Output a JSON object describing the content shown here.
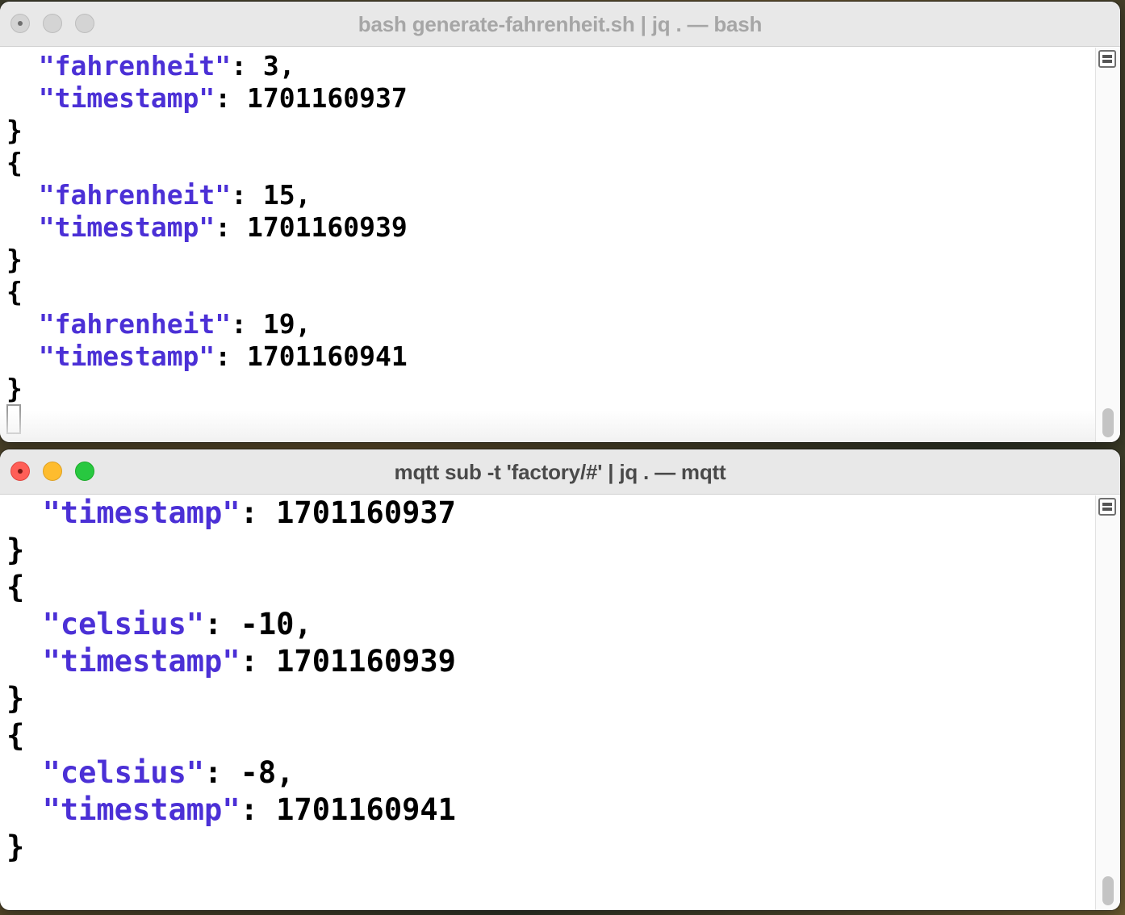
{
  "windows": [
    {
      "title": "bash generate-fahrenheit.sh | jq . — bash",
      "active": false,
      "lines": [
        {
          "indent": "  ",
          "key": "\"fahrenheit\"",
          "rest": ": 3,"
        },
        {
          "indent": "  ",
          "key": "\"timestamp\"",
          "rest": ": 1701160937"
        },
        {
          "indent": "",
          "key": "",
          "rest": "}"
        },
        {
          "indent": "",
          "key": "",
          "rest": "{"
        },
        {
          "indent": "  ",
          "key": "\"fahrenheit\"",
          "rest": ": 15,"
        },
        {
          "indent": "  ",
          "key": "\"timestamp\"",
          "rest": ": 1701160939"
        },
        {
          "indent": "",
          "key": "",
          "rest": "}"
        },
        {
          "indent": "",
          "key": "",
          "rest": "{"
        },
        {
          "indent": "  ",
          "key": "\"fahrenheit\"",
          "rest": ": 19,"
        },
        {
          "indent": "  ",
          "key": "\"timestamp\"",
          "rest": ": 1701160941"
        },
        {
          "indent": "",
          "key": "",
          "rest": "}"
        }
      ]
    },
    {
      "title": "mqtt sub -t 'factory/#' | jq . — mqtt",
      "active": true,
      "lines": [
        {
          "indent": "  ",
          "key": "\"timestamp\"",
          "rest": ": 1701160937"
        },
        {
          "indent": "",
          "key": "",
          "rest": "}"
        },
        {
          "indent": "",
          "key": "",
          "rest": "{"
        },
        {
          "indent": "  ",
          "key": "\"celsius\"",
          "rest": ": -10,"
        },
        {
          "indent": "  ",
          "key": "\"timestamp\"",
          "rest": ": 1701160939"
        },
        {
          "indent": "",
          "key": "",
          "rest": "}"
        },
        {
          "indent": "",
          "key": "",
          "rest": "{"
        },
        {
          "indent": "  ",
          "key": "\"celsius\"",
          "rest": ": -8,"
        },
        {
          "indent": "  ",
          "key": "\"timestamp\"",
          "rest": ": 1701160941"
        },
        {
          "indent": "",
          "key": "",
          "rest": "}"
        }
      ]
    }
  ],
  "colors": {
    "json_key": "#4b30d6",
    "text": "#000000"
  },
  "icons": {
    "close": "close-icon",
    "minimize": "minimize-icon",
    "zoom": "zoom-icon",
    "split_pane": "split-pane-icon"
  }
}
